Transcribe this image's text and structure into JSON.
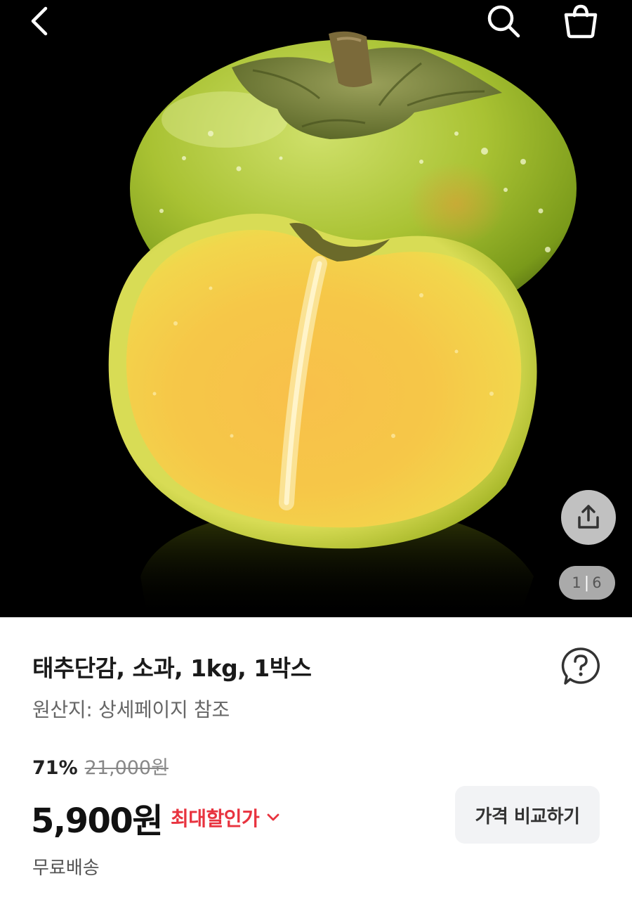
{
  "gallery": {
    "current_page": "1",
    "separator": "|",
    "total_pages": "6"
  },
  "product": {
    "title": "태추단감, 소과, 1kg, 1박스",
    "origin": "원산지: 상세페이지 참조",
    "discount_rate": "71%",
    "original_price": "21,000원",
    "price": "5,900원",
    "max_discount_label": "최대할인가",
    "shipping": "무료배송"
  },
  "actions": {
    "compare_label": "가격 비교하기"
  },
  "icons": {
    "back": "chevron-left-icon",
    "search": "search-icon",
    "cart": "shopping-bag-icon",
    "share": "share-icon",
    "qa": "question-bubble-icon",
    "dropdown": "chevron-down-icon"
  },
  "colors": {
    "accent_red": "#e8333f",
    "compare_bg": "#f2f3f5",
    "hero_bg": "#000000"
  }
}
